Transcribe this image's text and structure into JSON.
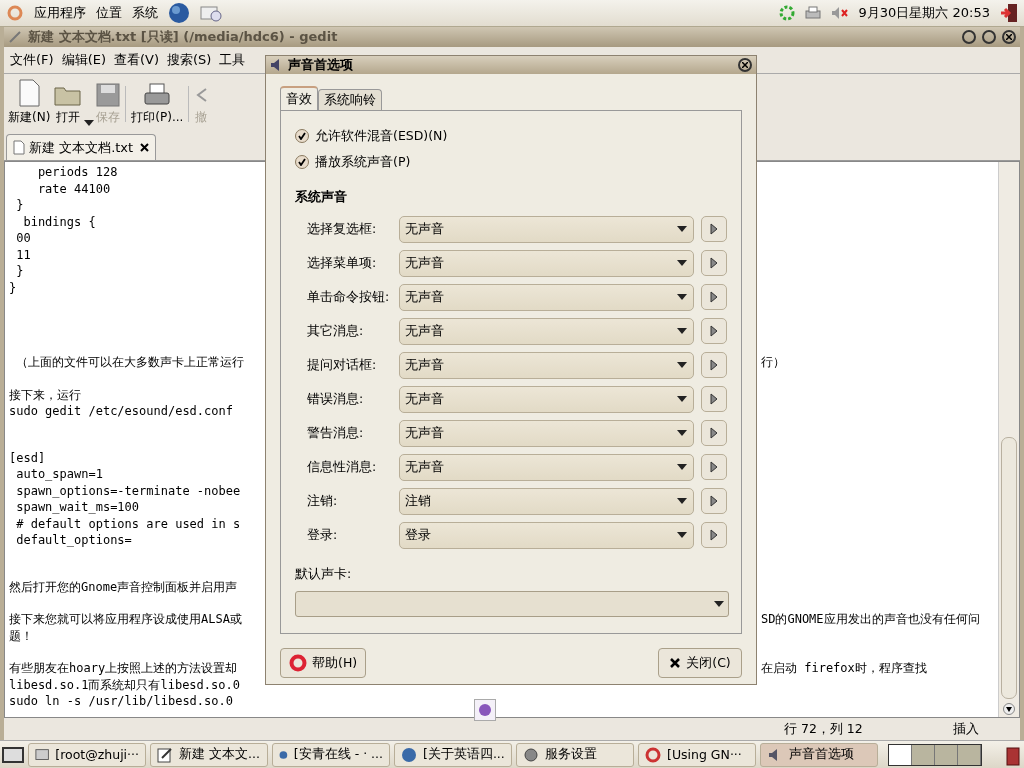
{
  "top_panel": {
    "menus": [
      "应用程序",
      "位置",
      "系统"
    ],
    "clock": "9月30日星期六 20:53"
  },
  "editor": {
    "title": "新建 文本文档.txt [只读] (/media/hdc6) - gedit",
    "menu": [
      "文件(F)",
      "编辑(E)",
      "查看(V)",
      "搜索(S)",
      "工具"
    ],
    "toolbar": [
      {
        "kind": "new",
        "label": "新建(N)",
        "disabled": false
      },
      {
        "kind": "open",
        "label": "打开",
        "disabled": false
      },
      {
        "kind": "save",
        "label": "保存",
        "disabled": true
      },
      {
        "kind": "print",
        "label": "打印(P)...",
        "disabled": false
      },
      {
        "kind": "undo",
        "label": "撤",
        "disabled": true
      }
    ],
    "tab": "新建 文本文档.txt",
    "blocks": [
      {
        "lines": [
          {
            "text": "    periods 128"
          },
          {
            "text": "    rate 44100"
          },
          {
            "text": " }"
          },
          {
            "text": "  bindings {"
          },
          {
            "text": " 00"
          },
          {
            "text": " 11"
          },
          {
            "text": " }"
          },
          {
            "text": "}"
          }
        ]
      },
      {
        "lines": [
          {
            "text": " （上面的文件可以在大多数声卡上正常运行",
            "right": "行）"
          }
        ]
      },
      {
        "lines": [
          {
            "text": "接下来，运行"
          },
          {
            "text": "sudo gedit /etc/esound/esd.conf"
          }
        ]
      },
      {
        "lines": [
          {
            "text": "[esd]"
          },
          {
            "text": " auto_spawn=1"
          },
          {
            "text": " spawn_options=-terminate -nobee"
          },
          {
            "text": " spawn_wait_ms=100"
          },
          {
            "text": " # default options are used in s"
          },
          {
            "text": " default_options="
          }
        ]
      },
      {
        "lines": [
          {
            "text": "然后打开您的Gnome声音控制面板并启用声"
          }
        ]
      },
      {
        "lines": [
          {
            "text": "接下来您就可以将应用程序设成使用ALSA或",
            "right": "SD的GNOME应用发出的声音也没有任何问"
          },
          {
            "text": "题！"
          }
        ]
      },
      {
        "lines": [
          {
            "text": "有些朋友在hoary上按照上述的方法设置却",
            "right": "在启动 firefox时，程序查找"
          },
          {
            "text": "libesd.so.1而系统却只有libesd.so.0"
          },
          {
            "text": "sudo ln -s /usr/lib/libesd.so.0"
          }
        ]
      }
    ],
    "status": {
      "position": "行 72，列 12",
      "mode": "插入"
    }
  },
  "dialog": {
    "title": "声音首选项",
    "tabs": [
      {
        "label": "音效",
        "selected": true
      },
      {
        "label": "系统响铃",
        "selected": false
      }
    ],
    "checkboxes": [
      {
        "label": "允许软件混音(ESD)(N)",
        "checked": true
      },
      {
        "label": "播放系统声音(P)",
        "checked": true
      }
    ],
    "section": "系统声音",
    "sounds": [
      {
        "label": "选择复选框:",
        "value": "无声音"
      },
      {
        "label": "选择菜单项:",
        "value": "无声音"
      },
      {
        "label": "单击命令按钮:",
        "value": "无声音"
      },
      {
        "label": "其它消息:",
        "value": "无声音"
      },
      {
        "label": "提问对话框:",
        "value": "无声音"
      },
      {
        "label": "错误消息:",
        "value": "无声音"
      },
      {
        "label": "警告消息:",
        "value": "无声音"
      },
      {
        "label": "信息性消息:",
        "value": "无声音"
      },
      {
        "label": "注销:",
        "value": "注销"
      },
      {
        "label": "登录:",
        "value": "登录"
      }
    ],
    "card_label": "默认声卡:",
    "buttons": [
      {
        "kind": "help",
        "label": "帮助(H)"
      },
      {
        "kind": "close",
        "label": "关闭(C)"
      }
    ]
  },
  "taskbar": [
    {
      "kind": "terminal",
      "label": "[root@zhuji···",
      "selected": false
    },
    {
      "kind": "editor",
      "label": "新建 文本文...",
      "selected": false
    },
    {
      "kind": "browser",
      "label": "[安青在线 - ·  ...",
      "selected": false
    },
    {
      "kind": "browser",
      "label": "[关于英语四...",
      "selected": false
    },
    {
      "kind": "settings",
      "label": "服务设置",
      "selected": false
    },
    {
      "kind": "help",
      "label": "[Using GN···",
      "selected": false
    },
    {
      "kind": "sound",
      "label": "声音首选项",
      "selected": true
    }
  ]
}
